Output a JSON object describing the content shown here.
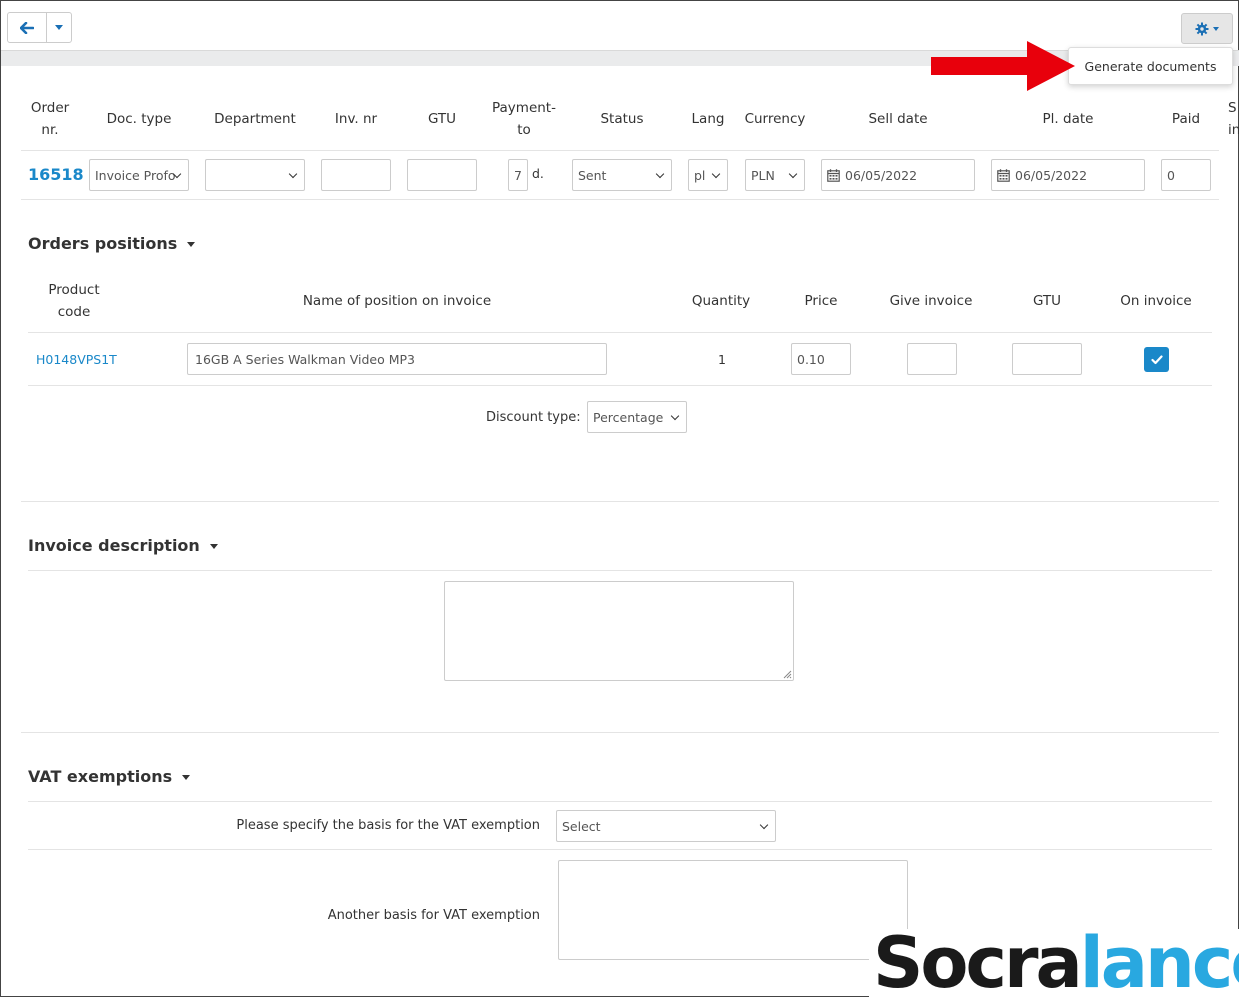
{
  "toolbar": {
    "back_icon": "arrow-left-icon",
    "caret_icon": "chevron-down-icon",
    "settings_icon": "gear-icon",
    "menu_item_generate": "Generate documents",
    "annotation_arrow_color": "#e8000c"
  },
  "order_table": {
    "headers": {
      "order_nr": "Order nr.",
      "doc_type": "Doc. type",
      "department": "Department",
      "inv_nr": "Inv. nr",
      "gtu": "GTU",
      "payment_to": "Payment- to",
      "status": "Status",
      "lang": "Lang",
      "currency": "Currency",
      "sell_date": "Sell date",
      "pl_date": "Pl. date",
      "paid": "Paid"
    },
    "row": {
      "order_nr": "16518",
      "doc_type": "Invoice Profo",
      "department": "",
      "inv_nr": "",
      "gtu": "",
      "payment_days": "7",
      "payment_unit": "d.",
      "status": "Sent",
      "lang": "pl",
      "currency": "PLN",
      "sell_date": "06/05/2022",
      "pl_date": "06/05/2022",
      "paid": "0"
    }
  },
  "orders_positions": {
    "title": "Orders positions",
    "headers": {
      "product_code": "Product code",
      "name": "Name of position on invoice",
      "quantity": "Quantity",
      "price": "Price",
      "give_invoice": "Give invoice",
      "gtu": "GTU",
      "on_invoice": "On invoice"
    },
    "row": {
      "product_code": "H0148VPS1T",
      "name": "16GB A Series Walkman Video MP3",
      "quantity": "1",
      "price": "0.10",
      "give_invoice": "",
      "gtu": "",
      "on_invoice": true
    },
    "discount_label": "Discount type:",
    "discount_value": "Percentage"
  },
  "invoice_description": {
    "title": "Invoice description",
    "value": ""
  },
  "vat_exemptions": {
    "title": "VAT exemptions",
    "basis_label": "Please specify the basis for the VAT exemption",
    "basis_value": "Select",
    "another_label": "Another basis for VAT exemption",
    "another_value": ""
  },
  "logo": {
    "part1": "Socra",
    "part2": "lance",
    "color1": "#1a1a1a",
    "color2": "#29a8e0"
  }
}
